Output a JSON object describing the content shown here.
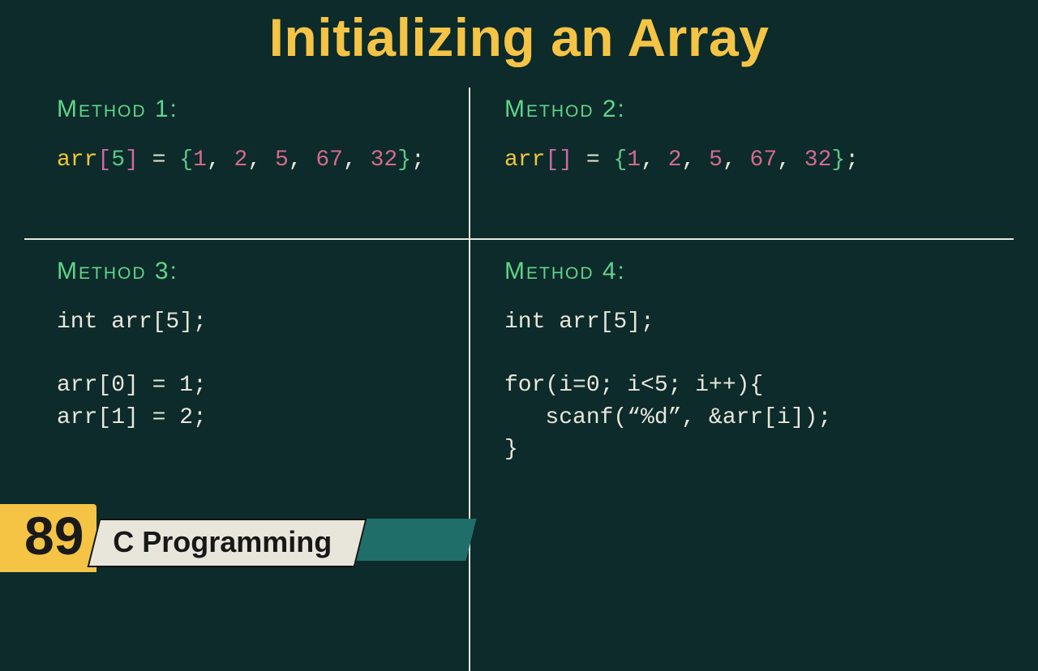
{
  "title": "Initializing an Array",
  "methods": {
    "m1": {
      "label": "Method 1:"
    },
    "m2": {
      "label": "Method 2:"
    },
    "m3": {
      "label": "Method 3:"
    },
    "m4": {
      "label": "Method 4:"
    }
  },
  "code": {
    "m1": {
      "arr": "arr",
      "lb": "[",
      "idx": "5",
      "rb": "]",
      "eq": " = ",
      "ob": "{",
      "n1": "1",
      "c": ", ",
      "n2": "2",
      "n3": "5",
      "n4": "67",
      "n5": "32",
      "cb": "}",
      "semi": ";"
    },
    "m2": {
      "arr": "arr",
      "lb": "[",
      "rb": "]",
      "eq": " = ",
      "ob": "{",
      "n1": "1",
      "c": ", ",
      "n2": "2",
      "n3": "5",
      "n4": "67",
      "n5": "32",
      "cb": "}",
      "semi": ";"
    },
    "m3": {
      "l1": "int arr[5];",
      "l2": "arr[0] = 1;",
      "l3": "arr[1] = 2;"
    },
    "m4": {
      "l1": "int arr[5];",
      "l2": "for(i=0; i<5; i++){",
      "l3": "   scanf(“%d”, &arr[i]);",
      "l4": "}"
    }
  },
  "badge": {
    "number": "89",
    "text": "C Programming"
  },
  "colors": {
    "bg": "#0c2b2a",
    "accent": "#f5c445",
    "method": "#62d38b",
    "code": "#e8e6db"
  }
}
